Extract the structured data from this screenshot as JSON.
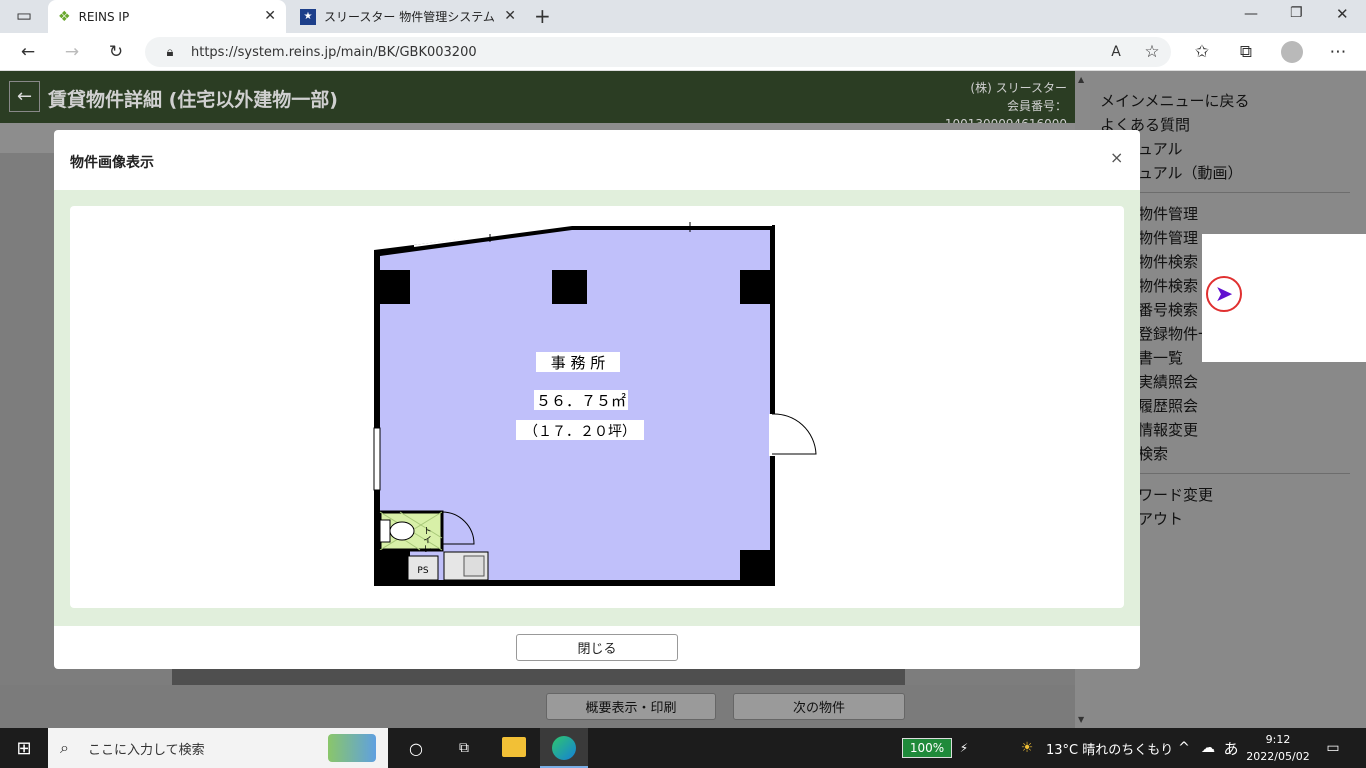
{
  "browser": {
    "tabs": [
      {
        "label": "REINS IP"
      },
      {
        "label": "スリースター 物件管理システム"
      }
    ],
    "url": "https://system.reins.jp/main/BK/GBK003200"
  },
  "page": {
    "title": "賃貸物件詳細 (住宅以外建物一部)",
    "company": "(株) スリースター",
    "member_no": "会員番号：1001300094616000"
  },
  "sidebar": {
    "group1": [
      "メインメニューに戻る",
      "よくある質問",
      "ュアル",
      "ュアル（動画）"
    ],
    "group2": [
      "物件管理",
      "物件管理",
      "物件検索",
      "物件検索",
      "番号検索",
      "登録物件一",
      "書一覧",
      "実績照会",
      "履歴照会",
      "情報変更",
      "検索"
    ],
    "group3": [
      "ワード変更",
      "アウト"
    ]
  },
  "bottom_buttons": [
    "概要表示・印刷",
    "次の物件"
  ],
  "modal": {
    "title": "物件画像表示",
    "close_x": "×",
    "close_button": "閉じる",
    "floorplan": {
      "room": "事 務 所",
      "area": "５６．７５㎡",
      "tsubo": "（１７．２０坪）",
      "toilet": "トイレ",
      "ps": "PS"
    }
  },
  "taskbar": {
    "search_placeholder": "ここに入力して検索",
    "battery": "100%",
    "weather": "13°C  晴れのちくもり",
    "ime": "あ",
    "time": "9:12",
    "date": "2022/05/02"
  },
  "colors": {
    "header": "#2b3d23",
    "room_fill": "#c0c0fa",
    "accent_blue": "#0078d4"
  }
}
